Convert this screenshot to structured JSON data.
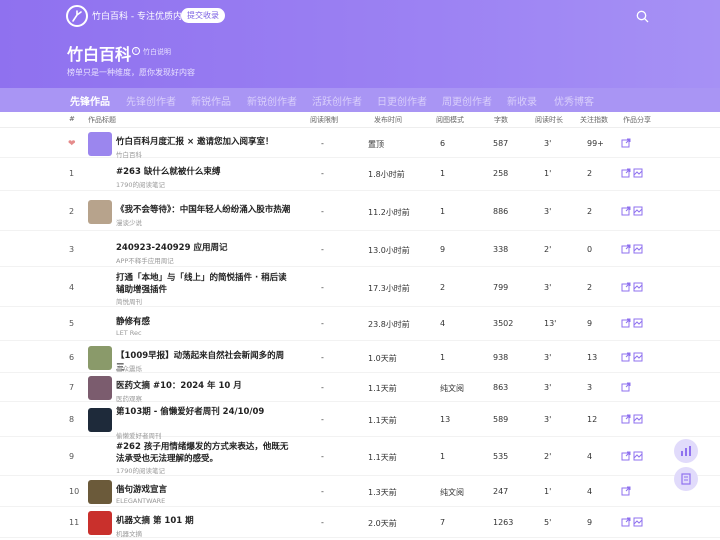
{
  "header": {
    "site_name": "竹白百科 - 专注优质内容",
    "submit_label": "提交收录",
    "title": "竹白百科",
    "info_label": "竹白说明",
    "subtitle": "榜单只是一种维度，愿你发现好内容"
  },
  "tabs": [
    "先锋作品",
    "先锋创作者",
    "新锐作品",
    "新锐创作者",
    "活跃创作者",
    "日更创作者",
    "周更创作者",
    "新收录",
    "优秀博客"
  ],
  "columns": [
    "#",
    "作品标题",
    "阅读限制",
    "发布时间",
    "阅图模式",
    "字数",
    "阅读时长",
    "关注指数",
    "作品分享"
  ],
  "rows": [
    {
      "rank": "",
      "title": "竹白百科月度汇报 × 邀请您加入阅享室！",
      "source": "竹白百科",
      "limit": "-",
      "time": "置顶",
      "mode": "6",
      "words": "587",
      "duration": "3'",
      "index": "99+"
    },
    {
      "rank": "1",
      "title": "#263 缺什么就被什么束缚",
      "source": "1790的阅读笔记",
      "limit": "-",
      "time": "1.8小时前",
      "mode": "1",
      "words": "258",
      "duration": "1'",
      "index": "2"
    },
    {
      "rank": "2",
      "title": "《我不会等待》：中国年轻人纷纷涌入股市热潮",
      "source": "漫谈少说",
      "limit": "-",
      "time": "11.2小时前",
      "mode": "1",
      "words": "886",
      "duration": "3'",
      "index": "2"
    },
    {
      "rank": "3",
      "title": "240923-240929 应用周记",
      "source": "APP不释手应用周记",
      "limit": "-",
      "time": "13.0小时前",
      "mode": "9",
      "words": "338",
      "duration": "2'",
      "index": "0"
    },
    {
      "rank": "4",
      "title": "打通「本地」与「线上」的简悦插件 · 稍后读辅助增强插件",
      "source": "简悦周刊",
      "limit": "-",
      "time": "17.3小时前",
      "mode": "2",
      "words": "799",
      "duration": "3'",
      "index": "2"
    },
    {
      "rank": "5",
      "title": "静修有感",
      "source": "LET Rec",
      "limit": "-",
      "time": "23.8小时前",
      "mode": "4",
      "words": "3502",
      "duration": "13'",
      "index": "9"
    },
    {
      "rank": "6",
      "title": "【1009早报】动荡起来自然社会新闻多的周三",
      "source": "当众震烁",
      "limit": "-",
      "time": "1.0天前",
      "mode": "1",
      "words": "938",
      "duration": "3'",
      "index": "13"
    },
    {
      "rank": "7",
      "title": "医药文摘 #10：2024 年 10 月",
      "source": "医药观察",
      "limit": "-",
      "time": "1.1天前",
      "mode": "纯文阅",
      "words": "863",
      "duration": "3'",
      "index": "3"
    },
    {
      "rank": "8",
      "title": "第103期 - 偷懒爱好者周刊 24/10/09",
      "source": "偷懒爱好者周刊",
      "limit": "-",
      "time": "1.1天前",
      "mode": "13",
      "words": "589",
      "duration": "3'",
      "index": "12"
    },
    {
      "rank": "9",
      "title": "#262 孩子用情绪爆发的方式来表达，他既无法承受也无法理解的感受。",
      "source": "1790的阅读笔记",
      "limit": "-",
      "time": "1.1天前",
      "mode": "1",
      "words": "535",
      "duration": "2'",
      "index": "4"
    },
    {
      "rank": "10",
      "title": "偕句游戏宣言",
      "source": "ELEGANTWARE",
      "limit": "-",
      "time": "1.3天前",
      "mode": "纯文阅",
      "words": "247",
      "duration": "1'",
      "index": "4"
    },
    {
      "rank": "11",
      "title": "机器文摘 第 101 期",
      "source": "机器文摘",
      "limit": "-",
      "time": "2.0天前",
      "mode": "7",
      "words": "1263",
      "duration": "5'",
      "index": "9"
    }
  ],
  "colors": {
    "accent": "#8f71ef",
    "tab_bg": "#a995f4",
    "float": "#e1dbfb"
  }
}
